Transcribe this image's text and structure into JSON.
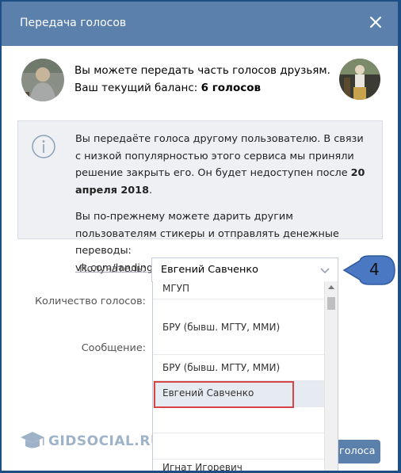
{
  "dialog": {
    "title": "Передача голосов"
  },
  "intro": {
    "line1": "Вы можете передать часть голосов друзьям.",
    "balance_label": "Ваш текущий баланс: ",
    "balance_value": "6 голосов"
  },
  "notice": {
    "p1_text": "Вы передаёте голоса другому пользователю. В связи с низкой популярностью этого сервиса мы приняли решение закрыть его. Он будет недоступен после ",
    "p1_date": "20 апреля 2018",
    "p1_end": ".",
    "p2_text": "Вы по-прежнему можете дарить другим пользователям стикеры и отправлять денежные переводы:",
    "link": "vk.com/landings/moneysend"
  },
  "form": {
    "recipient_label": "Получатель:",
    "recipient_value": "Евгений Савченко",
    "votes_label": "Количество голосов:",
    "message_label": "Сообщение:"
  },
  "dropdown": {
    "items": [
      "МГУП",
      "БРУ (бывш. МГТУ, ММИ)",
      "БРУ (бывш. МГТУ, ММИ)",
      "Евгений Савченко",
      "",
      "",
      "Игнат Игоревич"
    ],
    "highlighted_index": 3
  },
  "annotation": {
    "step": "4"
  },
  "footer": {
    "send_label": "голоса"
  },
  "watermark": {
    "text": "GIDSOCIAL.RU"
  },
  "colors": {
    "header": "#5b80ab",
    "highlight_border": "#d64545",
    "badge": "#4a78c2"
  }
}
